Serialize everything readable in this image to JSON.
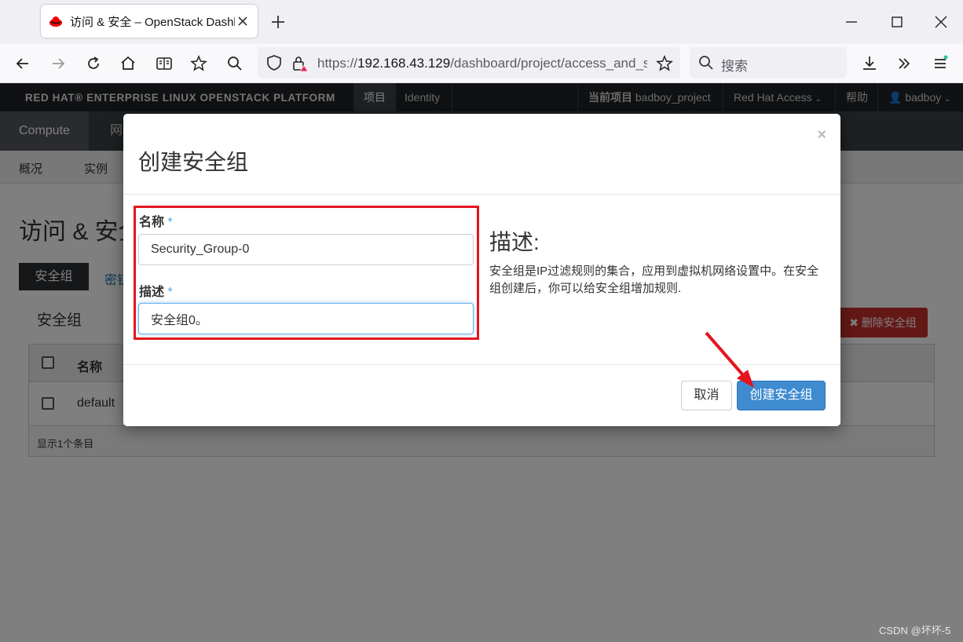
{
  "browser": {
    "tab_title": "访问 & 安全 – OpenStack Dashboard",
    "url_prefix": "https://",
    "url_host": "192.168.43.129",
    "url_path": "/dashboard/project/access_and_security/",
    "search_placeholder": "搜索"
  },
  "os": {
    "brand": "RED HAT® ENTERPRISE LINUX OPENSTACK PLATFORM",
    "top_tabs": [
      "项目",
      "Identity"
    ],
    "current_project_label": "当前项目",
    "current_project": "badboy_project",
    "red_hat_access": "Red Hat Access",
    "help": "帮助",
    "user": "badboy",
    "second_nav": [
      "Compute",
      "网"
    ],
    "third_nav": [
      "概况",
      "实例"
    ],
    "page_title": "访问 & 安全",
    "page_tabs": [
      "安全组",
      "密钥"
    ],
    "section_title": "安全组",
    "delete_button": "删除安全组",
    "table": {
      "header": "名称",
      "rows": [
        "default"
      ],
      "footer": "显示1个条目"
    }
  },
  "modal": {
    "title": "创建安全组",
    "name_label": "名称",
    "name_value": "Security_Group-0",
    "desc_label": "描述",
    "desc_value": "安全组0。",
    "required_mark": "*",
    "help_heading": "描述:",
    "help_text": "安全组是IP过滤规则的集合，应用到虚拟机网络设置中。在安全组创建后，你可以给安全组增加规则.",
    "cancel": "取消",
    "submit": "创建安全组",
    "close_symbol": "×"
  },
  "watermark": "CSDN @坏坏-5",
  "colors": {
    "accent": "#3e8bd0",
    "highlight": "#e5141f",
    "danger": "#c9302c"
  }
}
